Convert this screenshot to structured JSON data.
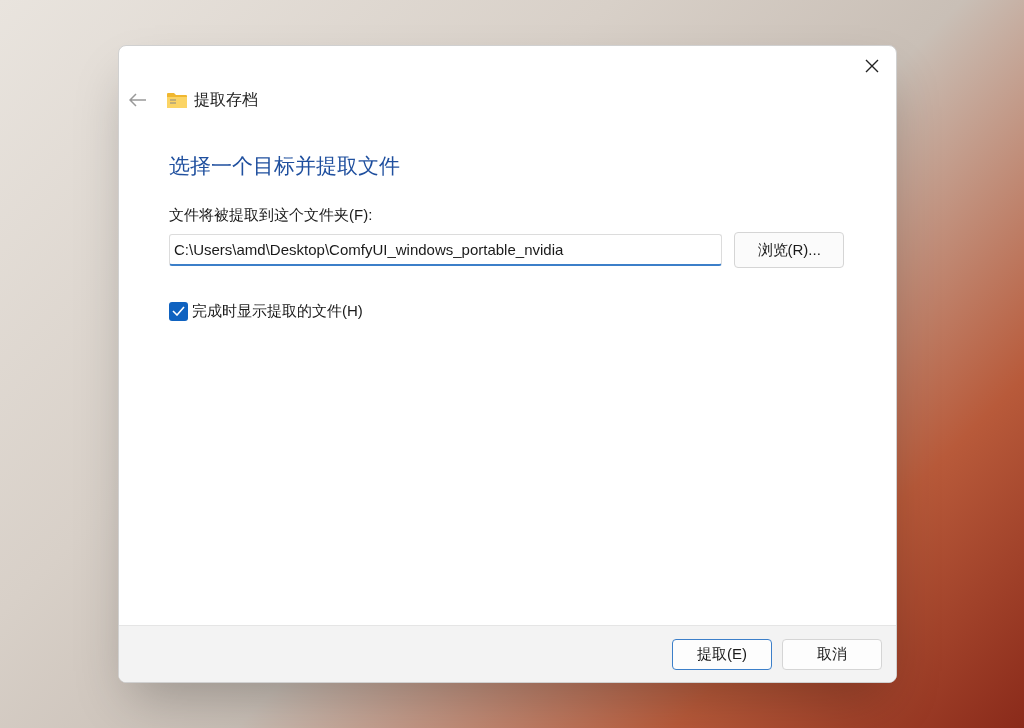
{
  "window": {
    "title": "提取存档"
  },
  "heading": "选择一个目标并提取文件",
  "destination": {
    "label": "文件将被提取到这个文件夹(F):",
    "value": "C:\\Users\\amd\\Desktop\\ComfyUI_windows_portable_nvidia",
    "browse_button": "浏览(R)..."
  },
  "show_files_checkbox": {
    "label": "完成时显示提取的文件(H)",
    "checked": true
  },
  "buttons": [
    {
      "label": "提取(E)",
      "selected": true
    },
    {
      "label": "取消",
      "selected": false
    }
  ]
}
